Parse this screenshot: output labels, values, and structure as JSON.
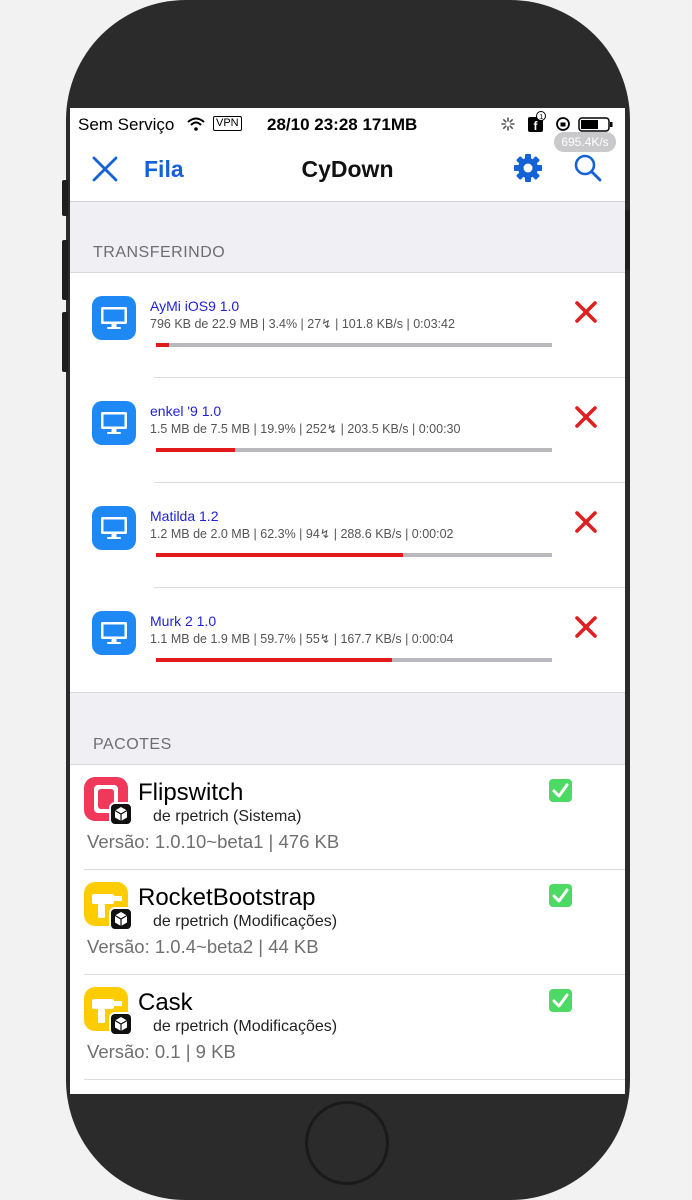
{
  "status_bar": {
    "carrier": "Sem Serviço",
    "vpn": "VPN",
    "datetime_memory": "28/10 23:28 171MB"
  },
  "nav": {
    "back_label": "Fila",
    "title": "CyDown",
    "speed": "695.4K/s"
  },
  "transfers": {
    "header": "TRANSFERINDO",
    "items": [
      {
        "name": "AyMi iOS9 1.0",
        "info": "796 KB de 22.9 MB | 3.4% | 27↯ | 101.8 KB/s | 0:03:42",
        "progress": 0.034
      },
      {
        "name": "enkel '9 1.0",
        "info": "1.5 MB de 7.5 MB | 19.9% | 252↯ | 203.5 KB/s | 0:00:30",
        "progress": 0.199
      },
      {
        "name": "Matilda 1.2",
        "info": "1.2 MB de 2.0 MB | 62.3% | 94↯ | 288.6 KB/s | 0:00:02",
        "progress": 0.623
      },
      {
        "name": "Murk 2 1.0",
        "info": "1.1 MB de 1.9 MB | 59.7% | 55↯ | 167.7 KB/s | 0:00:04",
        "progress": 0.597
      }
    ]
  },
  "packages": {
    "header": "PACOTES",
    "items": [
      {
        "name": "Flipswitch",
        "author": "de rpetrich (Sistema)",
        "version": "Versão: 1.0.10~beta1 | 476 KB",
        "icon": "flipswitch-icon",
        "icon_color": "#f0395a",
        "checked": true
      },
      {
        "name": "RocketBootstrap",
        "author": "de rpetrich (Modificações)",
        "version": "Versão: 1.0.4~beta2 | 44 KB",
        "icon": "drill-icon",
        "icon_color": "#ffcc00",
        "checked": true
      },
      {
        "name": "Cask",
        "author": "de rpetrich (Modificações)",
        "version": "Versão: 0.1 | 9 KB",
        "icon": "drill-icon",
        "icon_color": "#ffcc00",
        "checked": true
      }
    ]
  },
  "colors": {
    "accent": "#1463d6",
    "progress": "#e21b1b",
    "cancel": "#e02020",
    "check": "#4cd964"
  }
}
